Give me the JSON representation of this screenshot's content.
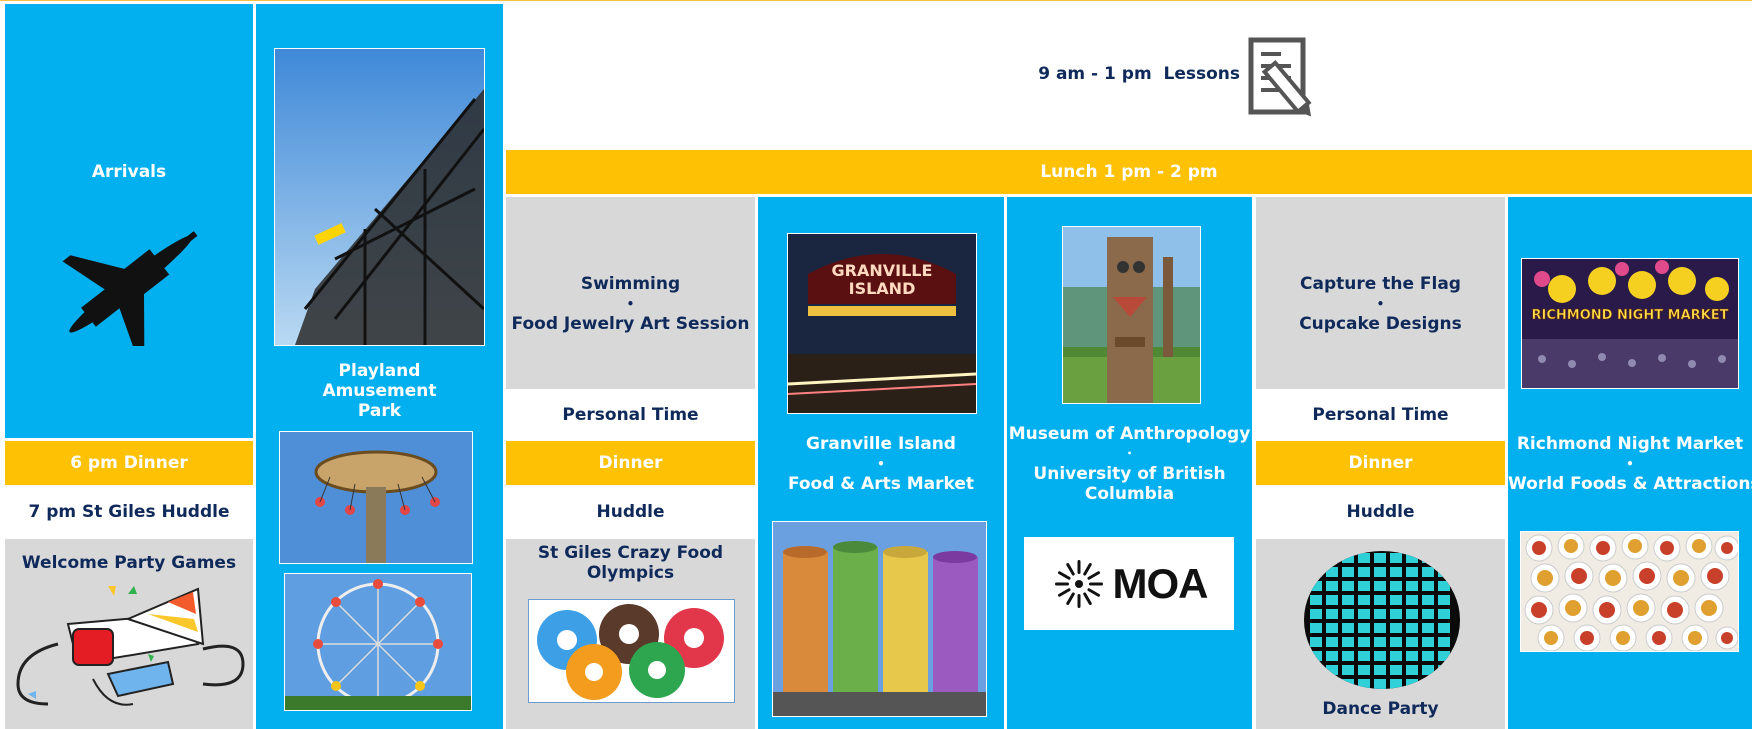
{
  "colors": {
    "blue": "#02b0ef",
    "gold": "#fec104",
    "grey": "#d8d8d8",
    "navy": "#0f2a5a"
  },
  "day1": {
    "arrivals": "Arrivals",
    "arrivals_icon": "airplane-icon",
    "dinner": "6 pm Dinner",
    "huddle": "7 pm St Giles Huddle",
    "games": "Welcome Party Games",
    "games_icon": "party-horn-icon"
  },
  "day2": {
    "title_line1": "Playland",
    "title_line2": "Amusement",
    "title_line3": "Park"
  },
  "header": {
    "lessons": "9 am - 1 pm  Lessons",
    "lessons_icon": "document-pencil-icon",
    "lunch": "Lunch 1 pm - 2 pm"
  },
  "day3": {
    "line1": "Swimming",
    "bullet": "•",
    "line2": "Food Jewelry Art Session",
    "personal": "Personal Time",
    "dinner": "Dinner",
    "huddle": "Huddle",
    "olympics_line1": "St Giles Crazy Food",
    "olympics_line2": "Olympics",
    "olympics_icon": "donuts-icon"
  },
  "day4": {
    "sign_line1": "GRANVILLE",
    "sign_line2": "ISLAND",
    "line1": "Granville Island",
    "bullet": "•",
    "line2": "Food & Arts Market"
  },
  "day5": {
    "line1": "Museum of Anthropology",
    "bullet": "•",
    "line2": "University of British",
    "line3": "Columbia",
    "logo_text": "MOA"
  },
  "day6": {
    "line1": "Capture the Flag",
    "bullet": "•",
    "line2": "Cupcake Designs",
    "personal": "Personal Time",
    "dinner": "Dinner",
    "huddle": "Huddle",
    "party": "Dance Party",
    "party_icon": "disco-ball-icon"
  },
  "day7": {
    "banner_text": "RICHMOND NIGHT MARKET",
    "line1": "Richmond Night Market",
    "bullet": "•",
    "line2": "World Foods & Attractions"
  }
}
